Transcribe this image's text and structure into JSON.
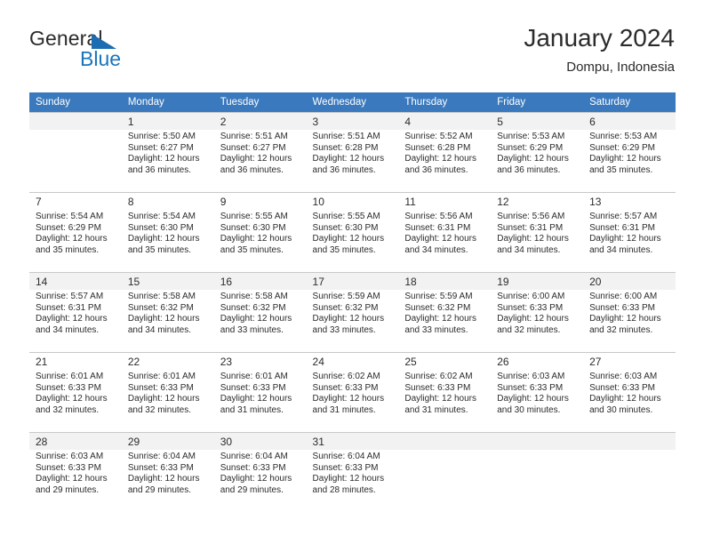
{
  "brand": {
    "name_part1": "General",
    "name_part2": "Blue",
    "flag_icon": "triangle-flag-icon"
  },
  "header": {
    "title": "January 2024",
    "location": "Dompu, Indonesia"
  },
  "calendar": {
    "weekday_headers": [
      "Sunday",
      "Monday",
      "Tuesday",
      "Wednesday",
      "Thursday",
      "Friday",
      "Saturday"
    ],
    "accent_color": "#3a79bd",
    "shaded_row_color": "#f2f2f2",
    "weeks": [
      [
        {
          "day": "",
          "sunrise": "",
          "sunset": "",
          "daylight1": "",
          "daylight2": ""
        },
        {
          "day": "1",
          "sunrise": "Sunrise: 5:50 AM",
          "sunset": "Sunset: 6:27 PM",
          "daylight1": "Daylight: 12 hours",
          "daylight2": "and 36 minutes."
        },
        {
          "day": "2",
          "sunrise": "Sunrise: 5:51 AM",
          "sunset": "Sunset: 6:27 PM",
          "daylight1": "Daylight: 12 hours",
          "daylight2": "and 36 minutes."
        },
        {
          "day": "3",
          "sunrise": "Sunrise: 5:51 AM",
          "sunset": "Sunset: 6:28 PM",
          "daylight1": "Daylight: 12 hours",
          "daylight2": "and 36 minutes."
        },
        {
          "day": "4",
          "sunrise": "Sunrise: 5:52 AM",
          "sunset": "Sunset: 6:28 PM",
          "daylight1": "Daylight: 12 hours",
          "daylight2": "and 36 minutes."
        },
        {
          "day": "5",
          "sunrise": "Sunrise: 5:53 AM",
          "sunset": "Sunset: 6:29 PM",
          "daylight1": "Daylight: 12 hours",
          "daylight2": "and 36 minutes."
        },
        {
          "day": "6",
          "sunrise": "Sunrise: 5:53 AM",
          "sunset": "Sunset: 6:29 PM",
          "daylight1": "Daylight: 12 hours",
          "daylight2": "and 35 minutes."
        }
      ],
      [
        {
          "day": "7",
          "sunrise": "Sunrise: 5:54 AM",
          "sunset": "Sunset: 6:29 PM",
          "daylight1": "Daylight: 12 hours",
          "daylight2": "and 35 minutes."
        },
        {
          "day": "8",
          "sunrise": "Sunrise: 5:54 AM",
          "sunset": "Sunset: 6:30 PM",
          "daylight1": "Daylight: 12 hours",
          "daylight2": "and 35 minutes."
        },
        {
          "day": "9",
          "sunrise": "Sunrise: 5:55 AM",
          "sunset": "Sunset: 6:30 PM",
          "daylight1": "Daylight: 12 hours",
          "daylight2": "and 35 minutes."
        },
        {
          "day": "10",
          "sunrise": "Sunrise: 5:55 AM",
          "sunset": "Sunset: 6:30 PM",
          "daylight1": "Daylight: 12 hours",
          "daylight2": "and 35 minutes."
        },
        {
          "day": "11",
          "sunrise": "Sunrise: 5:56 AM",
          "sunset": "Sunset: 6:31 PM",
          "daylight1": "Daylight: 12 hours",
          "daylight2": "and 34 minutes."
        },
        {
          "day": "12",
          "sunrise": "Sunrise: 5:56 AM",
          "sunset": "Sunset: 6:31 PM",
          "daylight1": "Daylight: 12 hours",
          "daylight2": "and 34 minutes."
        },
        {
          "day": "13",
          "sunrise": "Sunrise: 5:57 AM",
          "sunset": "Sunset: 6:31 PM",
          "daylight1": "Daylight: 12 hours",
          "daylight2": "and 34 minutes."
        }
      ],
      [
        {
          "day": "14",
          "sunrise": "Sunrise: 5:57 AM",
          "sunset": "Sunset: 6:31 PM",
          "daylight1": "Daylight: 12 hours",
          "daylight2": "and 34 minutes."
        },
        {
          "day": "15",
          "sunrise": "Sunrise: 5:58 AM",
          "sunset": "Sunset: 6:32 PM",
          "daylight1": "Daylight: 12 hours",
          "daylight2": "and 34 minutes."
        },
        {
          "day": "16",
          "sunrise": "Sunrise: 5:58 AM",
          "sunset": "Sunset: 6:32 PM",
          "daylight1": "Daylight: 12 hours",
          "daylight2": "and 33 minutes."
        },
        {
          "day": "17",
          "sunrise": "Sunrise: 5:59 AM",
          "sunset": "Sunset: 6:32 PM",
          "daylight1": "Daylight: 12 hours",
          "daylight2": "and 33 minutes."
        },
        {
          "day": "18",
          "sunrise": "Sunrise: 5:59 AM",
          "sunset": "Sunset: 6:32 PM",
          "daylight1": "Daylight: 12 hours",
          "daylight2": "and 33 minutes."
        },
        {
          "day": "19",
          "sunrise": "Sunrise: 6:00 AM",
          "sunset": "Sunset: 6:33 PM",
          "daylight1": "Daylight: 12 hours",
          "daylight2": "and 32 minutes."
        },
        {
          "day": "20",
          "sunrise": "Sunrise: 6:00 AM",
          "sunset": "Sunset: 6:33 PM",
          "daylight1": "Daylight: 12 hours",
          "daylight2": "and 32 minutes."
        }
      ],
      [
        {
          "day": "21",
          "sunrise": "Sunrise: 6:01 AM",
          "sunset": "Sunset: 6:33 PM",
          "daylight1": "Daylight: 12 hours",
          "daylight2": "and 32 minutes."
        },
        {
          "day": "22",
          "sunrise": "Sunrise: 6:01 AM",
          "sunset": "Sunset: 6:33 PM",
          "daylight1": "Daylight: 12 hours",
          "daylight2": "and 32 minutes."
        },
        {
          "day": "23",
          "sunrise": "Sunrise: 6:01 AM",
          "sunset": "Sunset: 6:33 PM",
          "daylight1": "Daylight: 12 hours",
          "daylight2": "and 31 minutes."
        },
        {
          "day": "24",
          "sunrise": "Sunrise: 6:02 AM",
          "sunset": "Sunset: 6:33 PM",
          "daylight1": "Daylight: 12 hours",
          "daylight2": "and 31 minutes."
        },
        {
          "day": "25",
          "sunrise": "Sunrise: 6:02 AM",
          "sunset": "Sunset: 6:33 PM",
          "daylight1": "Daylight: 12 hours",
          "daylight2": "and 31 minutes."
        },
        {
          "day": "26",
          "sunrise": "Sunrise: 6:03 AM",
          "sunset": "Sunset: 6:33 PM",
          "daylight1": "Daylight: 12 hours",
          "daylight2": "and 30 minutes."
        },
        {
          "day": "27",
          "sunrise": "Sunrise: 6:03 AM",
          "sunset": "Sunset: 6:33 PM",
          "daylight1": "Daylight: 12 hours",
          "daylight2": "and 30 minutes."
        }
      ],
      [
        {
          "day": "28",
          "sunrise": "Sunrise: 6:03 AM",
          "sunset": "Sunset: 6:33 PM",
          "daylight1": "Daylight: 12 hours",
          "daylight2": "and 29 minutes."
        },
        {
          "day": "29",
          "sunrise": "Sunrise: 6:04 AM",
          "sunset": "Sunset: 6:33 PM",
          "daylight1": "Daylight: 12 hours",
          "daylight2": "and 29 minutes."
        },
        {
          "day": "30",
          "sunrise": "Sunrise: 6:04 AM",
          "sunset": "Sunset: 6:33 PM",
          "daylight1": "Daylight: 12 hours",
          "daylight2": "and 29 minutes."
        },
        {
          "day": "31",
          "sunrise": "Sunrise: 6:04 AM",
          "sunset": "Sunset: 6:33 PM",
          "daylight1": "Daylight: 12 hours",
          "daylight2": "and 28 minutes."
        },
        {
          "day": "",
          "sunrise": "",
          "sunset": "",
          "daylight1": "",
          "daylight2": ""
        },
        {
          "day": "",
          "sunrise": "",
          "sunset": "",
          "daylight1": "",
          "daylight2": ""
        },
        {
          "day": "",
          "sunrise": "",
          "sunset": "",
          "daylight1": "",
          "daylight2": ""
        }
      ]
    ]
  }
}
